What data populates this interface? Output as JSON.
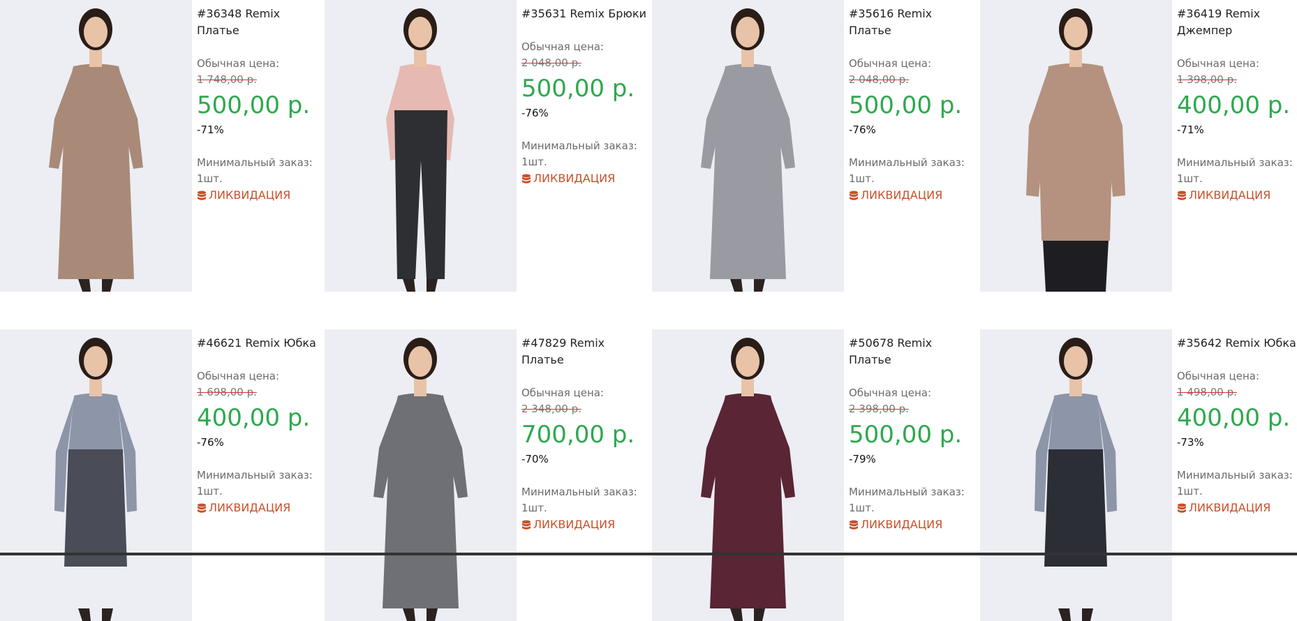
{
  "products": [
    {
      "title": "#36348 Remix Платье",
      "regular_label": "Обычная цена:",
      "old_price": "1 748,00 р.",
      "price": "500,00 р.",
      "discount": "-71%",
      "min_order_label": "Минимальный заказ:",
      "min_order_value": "1шт.",
      "tag": "ЛИКВИДАЦИЯ",
      "garment": "dress",
      "garment_color": "#a98a78"
    },
    {
      "title": "#35631 Remix Брюки",
      "regular_label": "Обычная цена:",
      "old_price": "2 048,00 р.",
      "price": "500,00 р.",
      "discount": "-76%",
      "min_order_label": "Минимальный заказ:",
      "min_order_value": "1шт.",
      "tag": "ЛИКВИДАЦИЯ",
      "garment": "trousers",
      "garment_color": "#2e2f33"
    },
    {
      "title": "#35616 Remix Платье",
      "regular_label": "Обычная цена:",
      "old_price": "2 048,00 р.",
      "price": "500,00 р.",
      "discount": "-76%",
      "min_order_label": "Минимальный заказ:",
      "min_order_value": "1шт.",
      "tag": "ЛИКВИДАЦИЯ",
      "garment": "dress",
      "garment_color": "#9a9aa2"
    },
    {
      "title": "#36419 Remix Джемпер",
      "regular_label": "Обычная цена:",
      "old_price": "1 398,00 р.",
      "price": "400,00 р.",
      "discount": "-71%",
      "min_order_label": "Минимальный заказ:",
      "min_order_value": "1шт.",
      "tag": "ЛИКВИДАЦИЯ",
      "garment": "top",
      "garment_color": "#b4927f"
    },
    {
      "title": "#46621 Remix Юбка",
      "regular_label": "Обычная цена:",
      "old_price": "1 698,00 р.",
      "price": "400,00 р.",
      "discount": "-76%",
      "min_order_label": "Минимальный заказ:",
      "min_order_value": "1шт.",
      "tag": "ЛИКВИДАЦИЯ",
      "garment": "skirt",
      "garment_color": "#4a4d57"
    },
    {
      "title": "#47829 Remix Платье",
      "regular_label": "Обычная цена:",
      "old_price": "2 348,00 р.",
      "price": "700,00 р.",
      "discount": "-70%",
      "min_order_label": "Минимальный заказ:",
      "min_order_value": "1шт.",
      "tag": "ЛИКВИДАЦИЯ",
      "garment": "dress",
      "garment_color": "#6f7075"
    },
    {
      "title": "#50678 Remix Платье",
      "regular_label": "Обычная цена:",
      "old_price": "2 398,00 р.",
      "price": "500,00 р.",
      "discount": "-79%",
      "min_order_label": "Минимальный заказ:",
      "min_order_value": "1шт.",
      "tag": "ЛИКВИДАЦИЯ",
      "garment": "dress",
      "garment_color": "#5a2535"
    },
    {
      "title": "#35642 Remix Юбка",
      "regular_label": "Обычная цена:",
      "old_price": "1 498,00 р.",
      "price": "400,00 р.",
      "discount": "-73%",
      "min_order_label": "Минимальный заказ:",
      "min_order_value": "1шт.",
      "tag": "ЛИКВИДАЦИЯ",
      "garment": "skirt",
      "garment_color": "#2c2e36"
    }
  ],
  "colors": {
    "price": "#2fa84f",
    "tag": "#c8502a",
    "strike": "#d3302f",
    "photo_bg": "#eceef3"
  },
  "icons": {
    "tag_icon": "database-icon"
  }
}
